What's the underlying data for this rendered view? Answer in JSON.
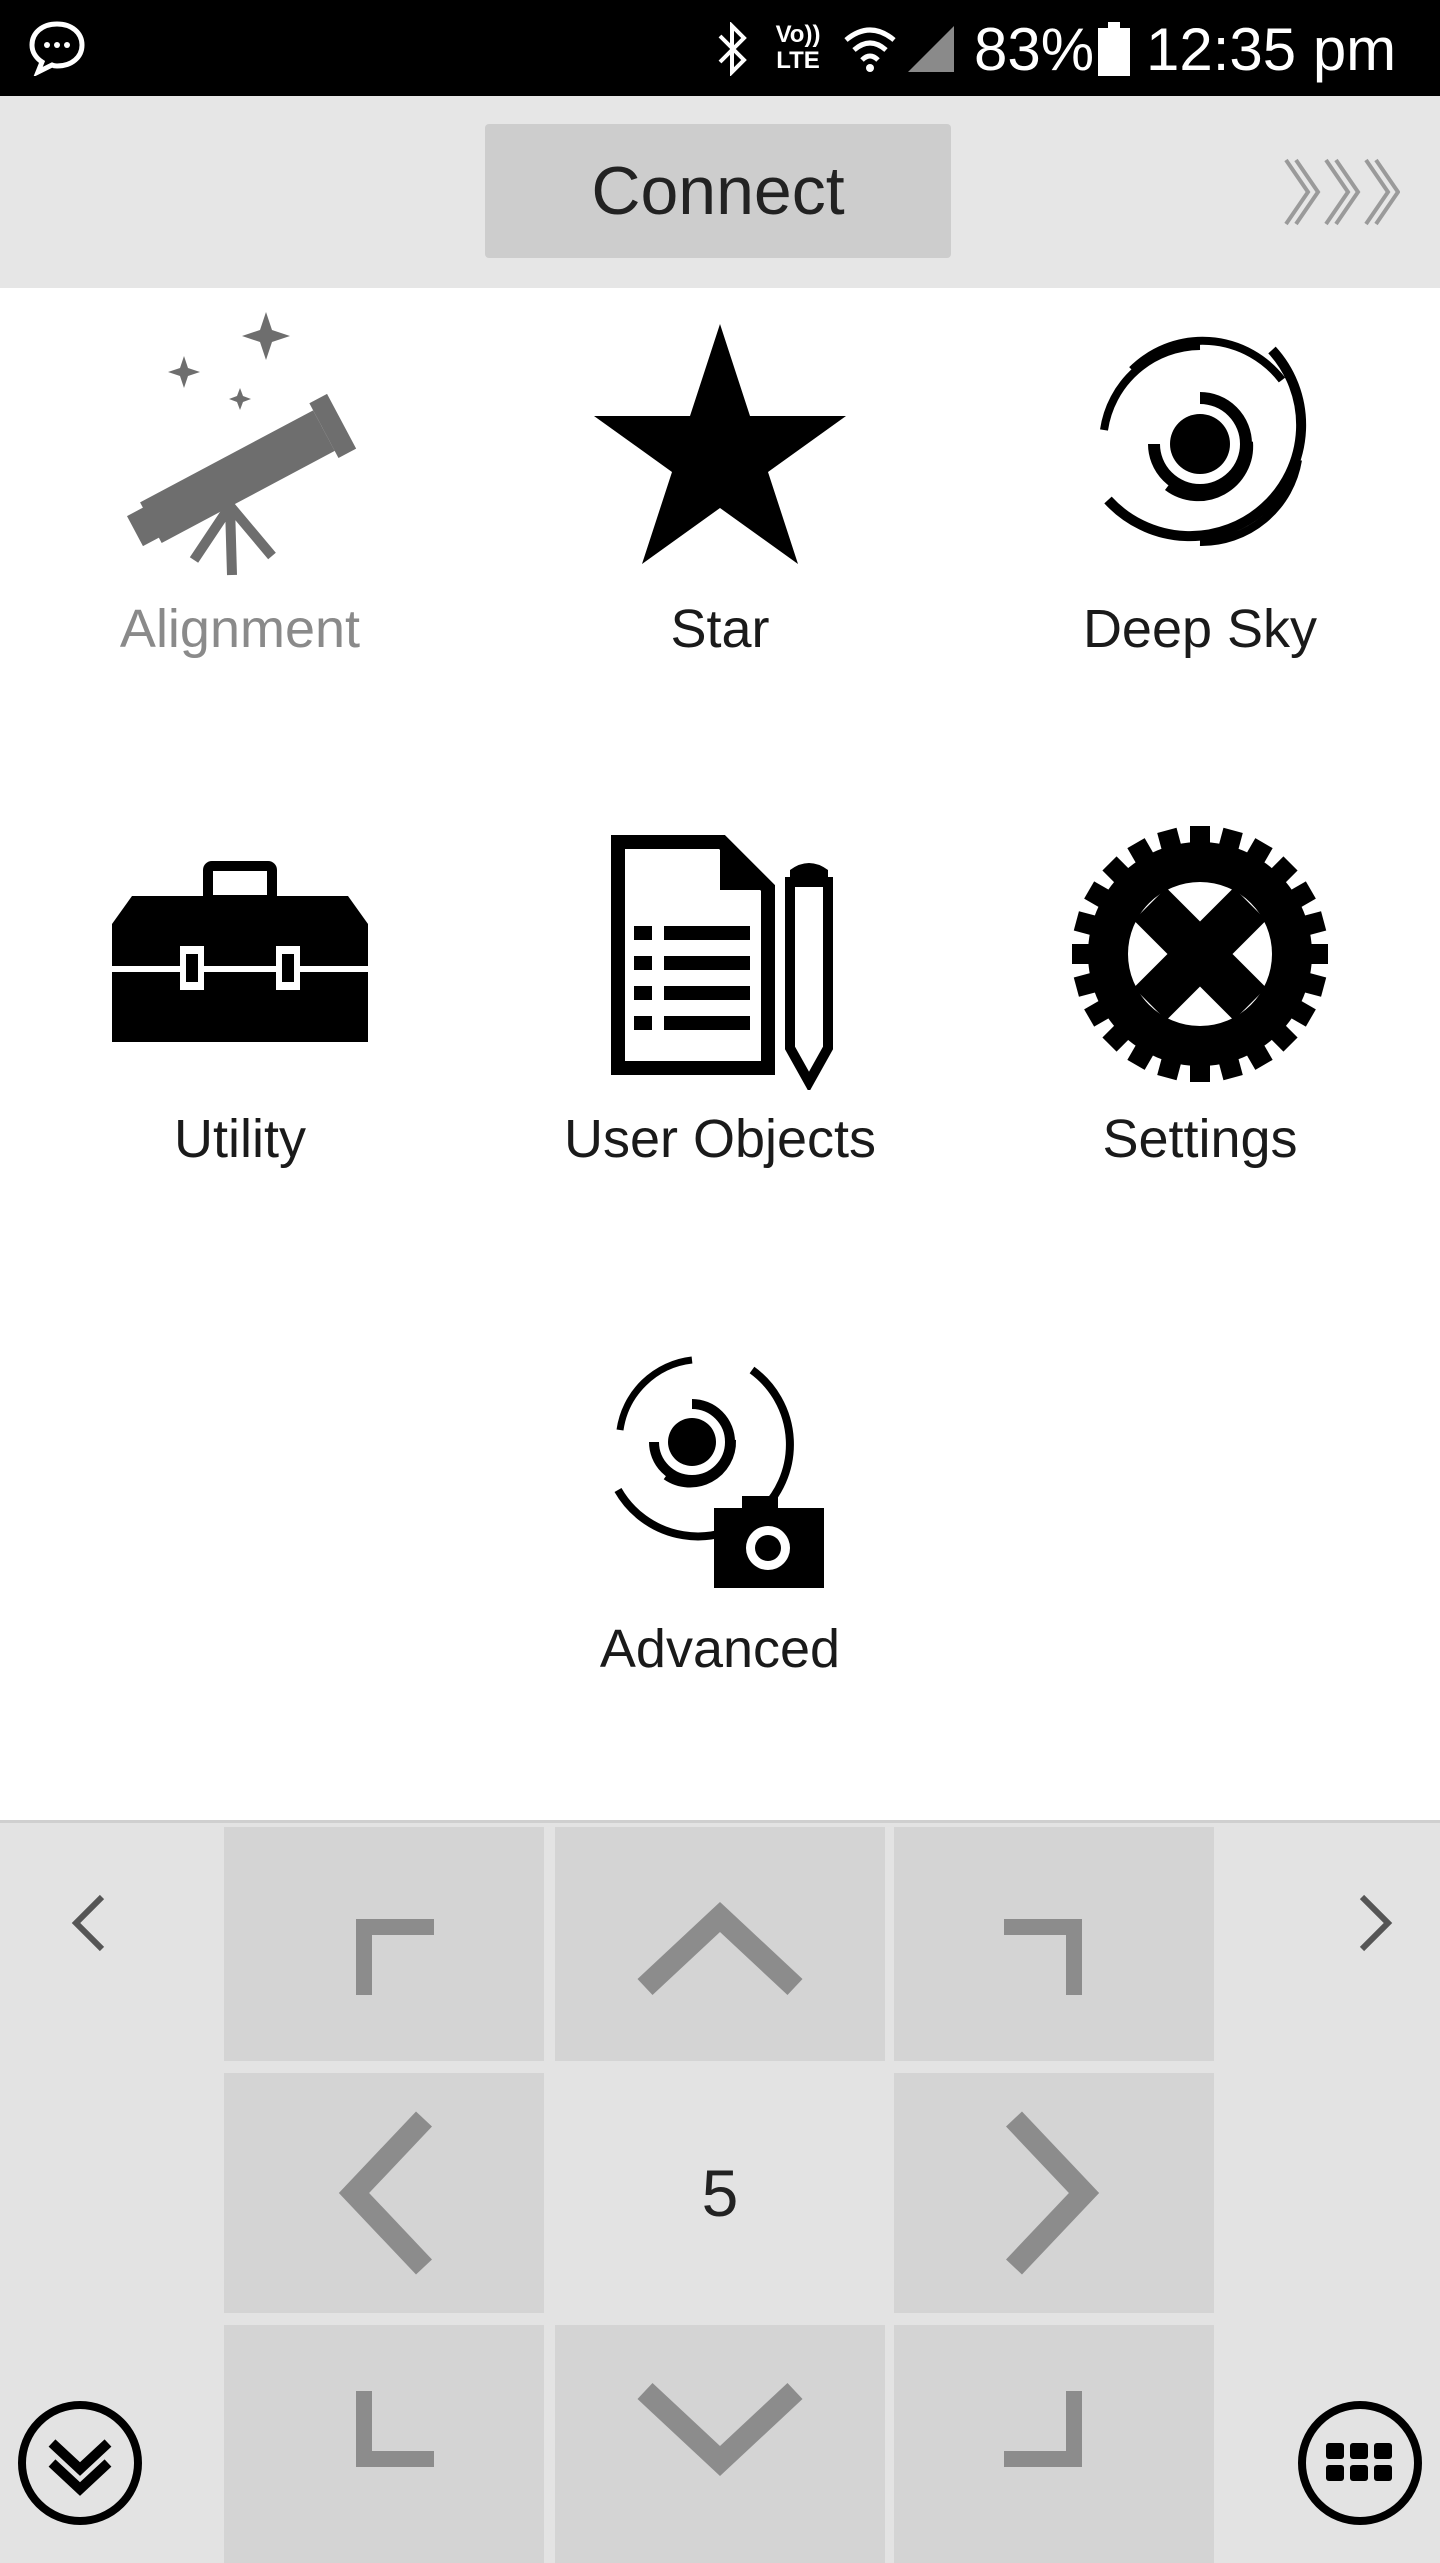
{
  "status_bar": {
    "battery": "83%",
    "time": "12:35 pm",
    "network": "LTE",
    "volte": "Vo))"
  },
  "top_bar": {
    "connect_label": "Connect",
    "more_icon": "triple-chevron-right-icon"
  },
  "menu": [
    {
      "label": "Alignment",
      "icon": "telescope-icon",
      "enabled": false
    },
    {
      "label": "Star",
      "icon": "star-icon",
      "enabled": true
    },
    {
      "label": "Deep Sky",
      "icon": "galaxy-icon",
      "enabled": true
    },
    {
      "label": "Utility",
      "icon": "toolbox-icon",
      "enabled": true
    },
    {
      "label": "User Objects",
      "icon": "document-pencil-icon",
      "enabled": true
    },
    {
      "label": "Settings",
      "icon": "gear-icon",
      "enabled": true
    },
    {
      "label": "Advanced",
      "icon": "galaxy-camera-icon",
      "enabled": true
    }
  ],
  "control_pad": {
    "speed": "5",
    "page_prev_icon": "chevron-left-icon",
    "page_next_icon": "chevron-right-icon",
    "collapse_icon": "double-chevron-down-icon",
    "keypad_icon": "keypad-grid-icon"
  },
  "colors": {
    "status_bar": "#000000",
    "top_bar": "#e6e6e6",
    "connect_button": "#cdcdcd",
    "pad_background": "#e3e3e3",
    "pad_button": "#d4d4d4",
    "arrow": "#8c8c8c",
    "disabled_label": "#8a8a8a"
  }
}
